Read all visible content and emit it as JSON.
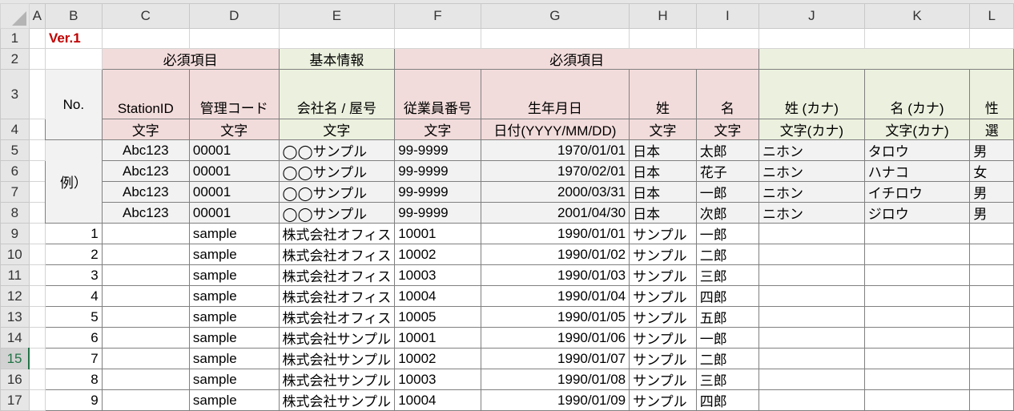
{
  "columns": [
    "A",
    "B",
    "C",
    "D",
    "E",
    "F",
    "G",
    "H",
    "I",
    "J",
    "K",
    "L"
  ],
  "version": "Ver.1",
  "group_headers": {
    "required_1": "必須項目",
    "basic_info": "基本情報",
    "required_2": "必須項目"
  },
  "field_headers": [
    "No.",
    "StationID",
    "管理コード",
    "会社名 / 屋号",
    "従業員番号",
    "生年月日",
    "姓",
    "名",
    "姓 (カナ)",
    "名 (カナ)",
    "性"
  ],
  "type_headers": [
    "文字",
    "文字",
    "文字",
    "文字",
    "日付(YYYY/MM/DD)",
    "文字",
    "文字",
    "文字(カナ)",
    "文字(カナ)",
    "選"
  ],
  "example_label": "例）",
  "example_rows": [
    [
      "Abc123",
      "00001",
      "◯◯サンプル",
      "99-9999",
      "1970/01/01",
      "日本",
      "太郎",
      "ニホン",
      "タロウ",
      "男"
    ],
    [
      "Abc123",
      "00001",
      "◯◯サンプル",
      "99-9999",
      "1970/02/01",
      "日本",
      "花子",
      "ニホン",
      "ハナコ",
      "女"
    ],
    [
      "Abc123",
      "00001",
      "◯◯サンプル",
      "99-9999",
      "2000/03/31",
      "日本",
      "一郎",
      "ニホン",
      "イチロウ",
      "男"
    ],
    [
      "Abc123",
      "00001",
      "◯◯サンプル",
      "99-9999",
      "2001/04/30",
      "日本",
      "次郎",
      "ニホン",
      "ジロウ",
      "男"
    ]
  ],
  "data_rows": [
    [
      "1",
      "",
      "sample",
      "株式会社オフィス",
      "10001",
      "1990/01/01",
      "サンプル",
      "一郎",
      "",
      "",
      ""
    ],
    [
      "2",
      "",
      "sample",
      "株式会社オフィス",
      "10002",
      "1990/01/02",
      "サンプル",
      "二郎",
      "",
      "",
      ""
    ],
    [
      "3",
      "",
      "sample",
      "株式会社オフィス",
      "10003",
      "1990/01/03",
      "サンプル",
      "三郎",
      "",
      "",
      ""
    ],
    [
      "4",
      "",
      "sample",
      "株式会社オフィス",
      "10004",
      "1990/01/04",
      "サンプル",
      "四郎",
      "",
      "",
      ""
    ],
    [
      "5",
      "",
      "sample",
      "株式会社オフィス",
      "10005",
      "1990/01/05",
      "サンプル",
      "五郎",
      "",
      "",
      ""
    ],
    [
      "6",
      "",
      "sample",
      "株式会社サンプル",
      "10001",
      "1990/01/06",
      "サンプル",
      "一郎",
      "",
      "",
      ""
    ],
    [
      "7",
      "",
      "sample",
      "株式会社サンプル",
      "10002",
      "1990/01/07",
      "サンプル",
      "二郎",
      "",
      "",
      ""
    ],
    [
      "8",
      "",
      "sample",
      "株式会社サンプル",
      "10003",
      "1990/01/08",
      "サンプル",
      "三郎",
      "",
      "",
      ""
    ],
    [
      "9",
      "",
      "sample",
      "株式会社サンプル",
      "10004",
      "1990/01/09",
      "サンプル",
      "四郎",
      "",
      "",
      ""
    ]
  ],
  "selected_row": "15",
  "colors": {
    "pink": "#f2dcdb",
    "green": "#ebf1de",
    "version_red": "#c00000"
  }
}
